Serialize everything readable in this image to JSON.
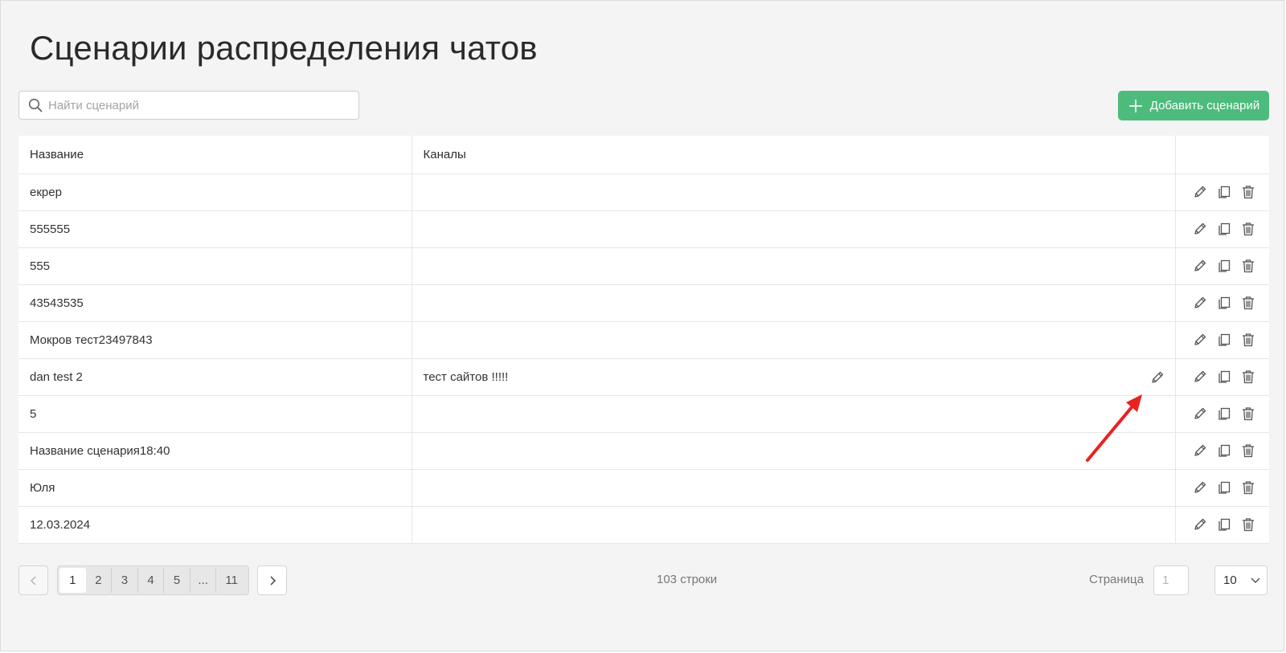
{
  "page": {
    "title": "Сценарии распределения чатов"
  },
  "search": {
    "placeholder": "Найти сценарий"
  },
  "toolbar": {
    "add_label": "Добавить сценарий"
  },
  "table": {
    "columns": [
      "Название",
      "Каналы"
    ],
    "rows": [
      {
        "name": "екрер",
        "channels": ""
      },
      {
        "name": "555555",
        "channels": ""
      },
      {
        "name": "555",
        "channels": ""
      },
      {
        "name": "43543535",
        "channels": ""
      },
      {
        "name": "Мокров тест23497843",
        "channels": ""
      },
      {
        "name": "dan test 2",
        "channels": "тест сайтов !!!!!"
      },
      {
        "name": "5",
        "channels": ""
      },
      {
        "name": "Название сценария18:40",
        "channels": ""
      },
      {
        "name": "Юля",
        "channels": ""
      },
      {
        "name": "12.03.2024",
        "channels": ""
      }
    ],
    "row_actions": [
      "edit-icon",
      "copy-icon",
      "delete-icon"
    ]
  },
  "pagination": {
    "pages": [
      "1",
      "2",
      "3",
      "4",
      "5",
      "...",
      "11"
    ],
    "current": "1",
    "rows_count": "103 строки",
    "page_label": "Страница",
    "page_input_placeholder": "1",
    "per_page": "10"
  },
  "annotation": {
    "arrow_color": "#e8221f"
  },
  "colors": {
    "accent": "#4dbb7c"
  }
}
